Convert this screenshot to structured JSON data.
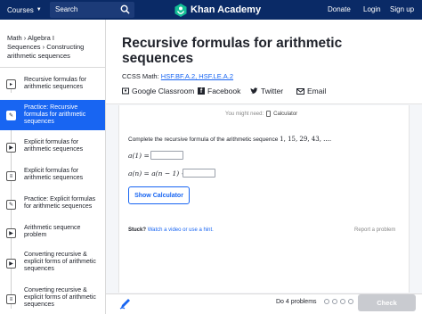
{
  "nav": {
    "courses": "Courses",
    "search_placeholder": "Search",
    "logo": "Khan Academy",
    "donate": "Donate",
    "login": "Login",
    "signup": "Sign up"
  },
  "breadcrumb": {
    "math": "Math",
    "algebra": "Algebra I",
    "sequences": "Sequences",
    "constructing": "Constructing arithmetic sequences"
  },
  "sidebar": {
    "items": [
      {
        "label": "Recursive formulas for arithmetic sequences",
        "icon": "video-icon"
      },
      {
        "label": "Practice: Recursive formulas for arithmetic sequences",
        "icon": "pencil-icon",
        "active": true
      },
      {
        "label": "Explicit formulas for arithmetic sequences",
        "icon": "play-icon"
      },
      {
        "label": "Explicit formulas for arithmetic sequences",
        "icon": "article-icon"
      },
      {
        "label": "Practice: Explicit formulas for arithmetic sequences",
        "icon": "pencil-icon"
      },
      {
        "label": "Arithmetic sequence problem",
        "icon": "play-icon"
      },
      {
        "label": "Converting recursive & explicit forms of arithmetic sequences",
        "icon": "play-icon"
      },
      {
        "label": "Converting recursive & explicit forms of arithmetic sequences",
        "icon": "article-icon"
      }
    ]
  },
  "main": {
    "title": "Recursive formulas for arithmetic sequences",
    "ccss_label": "CCSS Math:",
    "ccss_codes": "HSF.BF.A.2, HSF.LE.A.2",
    "share": {
      "google": "Google Classroom",
      "facebook": "Facebook",
      "twitter": "Twitter",
      "email": "Email"
    }
  },
  "exercise": {
    "might_need": "You might need:",
    "calculator": "Calculator",
    "prompt": "Complete the recursive formula of the arithmetic sequence",
    "sequence": "1, 15, 29, 43, ....",
    "line1_left": "a(1) =",
    "line2_left": "a(n) = a(n − 1) +",
    "show_calculator": "Show Calculator",
    "stuck": "Stuck?",
    "hint_link": "Watch a video or use a hint.",
    "report": "Report a problem"
  },
  "footer": {
    "do_problems": "Do 4 problems",
    "check": "Check"
  },
  "colors": {
    "nav_bg": "#0a2a66",
    "accent": "#1865f2",
    "check_disabled": "#c9cbd0"
  }
}
